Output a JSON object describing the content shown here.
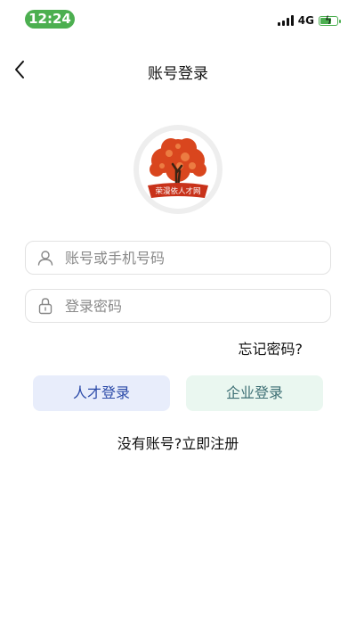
{
  "status_bar": {
    "time": "12:24",
    "network": "4G",
    "colors": {
      "time_pill": "#4caf50",
      "battery": "#4caf50"
    }
  },
  "nav": {
    "title": "账号登录",
    "back_icon": "chevron-left-icon"
  },
  "logo": {
    "text": "荣漫依人才网"
  },
  "form": {
    "account_placeholder": "账号或手机号码",
    "password_placeholder": "登录密码",
    "account_icon": "user-icon",
    "password_icon": "lock-icon",
    "forgot_label": "忘记密码?"
  },
  "buttons": {
    "talent_login": "人才登录",
    "company_login": "企业登录",
    "colors": {
      "talent_bg": "#e8edfb",
      "talent_text": "#2b4aa8",
      "company_bg": "#eaf7f0",
      "company_text": "#3d6f74"
    }
  },
  "register": {
    "prompt": "没有账号?",
    "link": "立即注册"
  }
}
